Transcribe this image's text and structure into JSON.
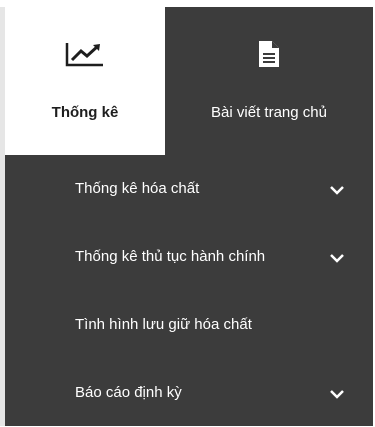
{
  "tabs": [
    {
      "label": "Thống kê",
      "icon": "line-chart-icon",
      "active": true
    },
    {
      "label": "Bài viết trang chủ",
      "icon": "document-icon",
      "active": false
    }
  ],
  "menu": {
    "items": [
      {
        "label": "Thống kê hóa chất",
        "has_submenu": true
      },
      {
        "label": "Thống kê thủ tục hành chính",
        "has_submenu": true
      },
      {
        "label": "Tình hình lưu giữ hóa chất",
        "has_submenu": false
      },
      {
        "label": "Báo cáo định kỳ",
        "has_submenu": true
      }
    ]
  },
  "colors": {
    "panel_bg": "#3c3c3c",
    "active_tab_bg": "#ffffff",
    "text_light": "#ffffff",
    "text_dark": "#1e1e1e"
  }
}
